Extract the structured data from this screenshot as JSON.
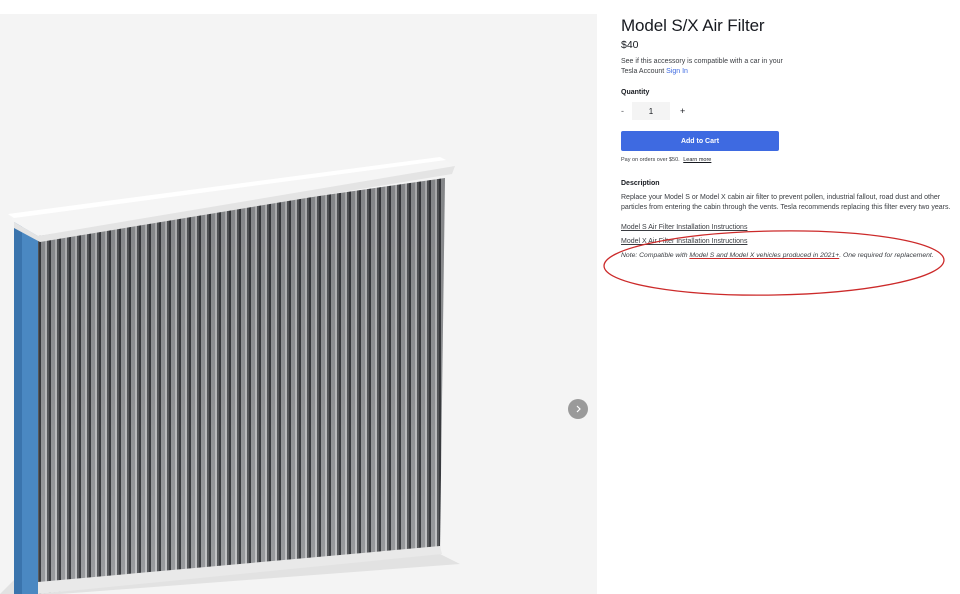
{
  "product": {
    "title": "Model S/X Air Filter",
    "price": "$40",
    "compat_text": "See if this accessory is compatible with a car in your Tesla Account",
    "sign_in": "Sign In"
  },
  "quantity": {
    "label": "Quantity",
    "minus": "-",
    "value": "1",
    "plus": "+"
  },
  "cart": {
    "add_label": "Add to Cart",
    "pay_text": "Pay on orders over $50.",
    "learn_more": "Learn more"
  },
  "description": {
    "heading": "Description",
    "body": "Replace your Model S or Model X cabin air filter to prevent pollen, industrial fallout, road dust and other particles from entering the cabin through the vents. Tesla recommends replacing this filter every two years.",
    "link_s": "Model S Air Filter Installation Instructions",
    "link_x": "Model X Air Filter Installation Instructions",
    "note_prefix": "Note: Compatible with ",
    "note_link": "Model S and Model X vehicles produced in 2021+",
    "note_suffix": ". One required for replacement."
  },
  "gallery": {
    "next_icon": "chevron-right-icon"
  },
  "colors": {
    "accent": "#3e6ae1",
    "annotation": "#cc2a2a"
  }
}
